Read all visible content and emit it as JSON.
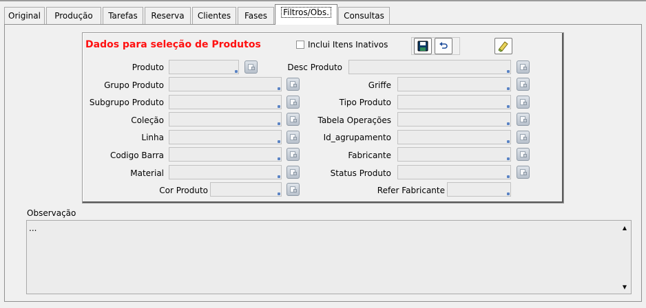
{
  "tabs": [
    {
      "label": "Original"
    },
    {
      "label": "Produção"
    },
    {
      "label": "Tarefas"
    },
    {
      "label": "Reserva"
    },
    {
      "label": "Clientes"
    },
    {
      "label": "Fases"
    },
    {
      "label": "Filtros/Obs."
    },
    {
      "label": "Consultas"
    }
  ],
  "active_tab": "Filtros/Obs.",
  "filters": {
    "title": "Dados para seleção de Produtos",
    "title_color": "#ff1010",
    "include_inactive": {
      "label": "Inclui Itens Inativos",
      "checked": false
    },
    "toolbar": {
      "save_icon": "save-icon",
      "undo_icon": "undo-icon",
      "clear_icon": "eraser-icon"
    },
    "fields": {
      "produto": {
        "label": "Produto",
        "value": ""
      },
      "desc_produto": {
        "label": "Desc Produto",
        "value": ""
      },
      "grupo_produto": {
        "label": "Grupo Produto",
        "value": ""
      },
      "griffe": {
        "label": "Griffe",
        "value": ""
      },
      "subgrupo_produto": {
        "label": "Subgrupo Produto",
        "value": ""
      },
      "tipo_produto": {
        "label": "Tipo Produto",
        "value": ""
      },
      "colecao": {
        "label": "Coleção",
        "value": ""
      },
      "tabela_operacoes": {
        "label": "Tabela Operações",
        "value": ""
      },
      "linha": {
        "label": "Linha",
        "value": ""
      },
      "id_agrupamento": {
        "label": "Id_agrupamento",
        "value": ""
      },
      "codigo_barra": {
        "label": "Codigo Barra",
        "value": ""
      },
      "fabricante": {
        "label": "Fabricante",
        "value": ""
      },
      "material": {
        "label": "Material",
        "value": ""
      },
      "status_produto": {
        "label": "Status Produto",
        "value": ""
      },
      "cor_produto": {
        "label": "Cor Produto",
        "value": ""
      },
      "refer_fabricante": {
        "label": "Refer Fabricante",
        "value": ""
      }
    }
  },
  "observacao": {
    "label": "Observação",
    "value": "..."
  }
}
